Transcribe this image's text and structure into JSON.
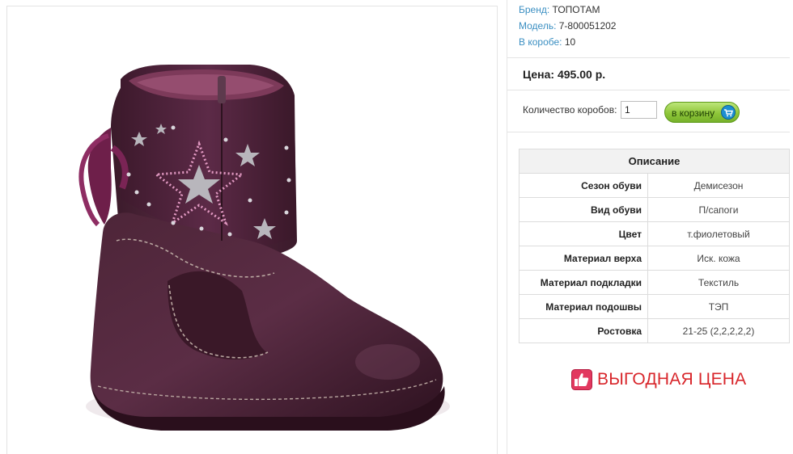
{
  "product": {
    "image_alt": "boot-product-image",
    "brand_label": "Бренд:",
    "brand_value": "ТОПОТАМ",
    "model_label": "Модель:",
    "model_value": "7-800051202",
    "box_label": "В коробе:",
    "box_value": "10"
  },
  "price": {
    "text": "Цена: 495.00 р."
  },
  "order": {
    "qty_label": "Количество коробов:",
    "qty_value": "1",
    "cart_label": "в корзину",
    "cart_icon": "cart-icon"
  },
  "specs": {
    "header": "Описание",
    "rows": [
      {
        "key": "Сезон обуви",
        "value": "Демисезон"
      },
      {
        "key": "Вид обуви",
        "value": "П/сапоги"
      },
      {
        "key": "Цвет",
        "value": "т.фиолетовый"
      },
      {
        "key": "Материал верха",
        "value": "Иск. кожа"
      },
      {
        "key": "Материал подкладки",
        "value": "Текстиль"
      },
      {
        "key": "Материал подошвы",
        "value": "ТЭП"
      },
      {
        "key": "Ростовка",
        "value": "21-25 (2,2,2,2,2)"
      }
    ]
  },
  "badge": {
    "text": "ВЫГОДНАЯ ЦЕНА",
    "icon": "thumbs-up-icon",
    "color": "#d8262b"
  },
  "colors": {
    "link_blue": "#3b8fc2",
    "cart_green": "#8fc63a",
    "boot_purple": "#4a2236"
  }
}
